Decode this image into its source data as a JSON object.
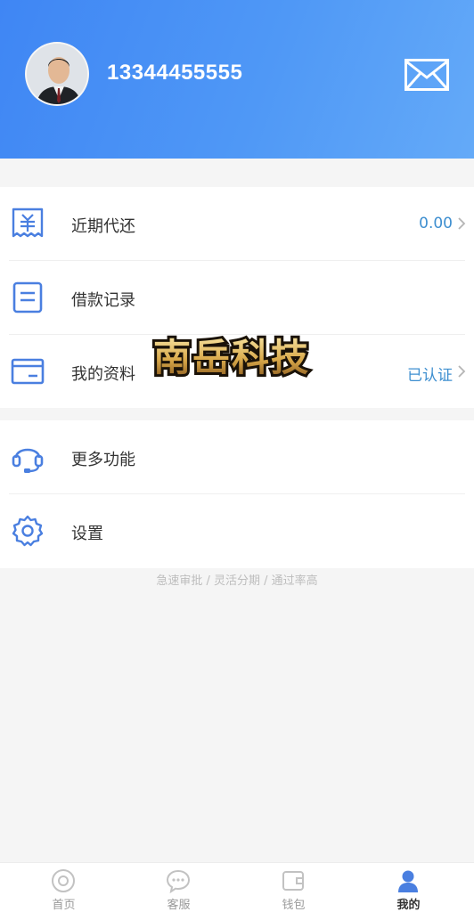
{
  "header": {
    "phone": "13344455555",
    "avatar_icon": "user-avatar",
    "mail_icon": "mail-icon"
  },
  "menu_primary": [
    {
      "label": "近期代还",
      "value": "0.00",
      "icon": "receipt-yuan-icon"
    },
    {
      "label": "借款记录",
      "value": "",
      "icon": "document-icon"
    },
    {
      "label": "我的资料",
      "value": "已认证",
      "icon": "card-icon"
    }
  ],
  "menu_secondary": [
    {
      "label": "更多功能",
      "icon": "headset-icon"
    },
    {
      "label": "设置",
      "icon": "gear-icon"
    }
  ],
  "slogan": "急速审批 / 灵活分期 / 通过率高",
  "watermark": "南岳科技",
  "tabs": [
    {
      "label": "首页",
      "icon": "home-icon"
    },
    {
      "label": "客服",
      "icon": "chat-icon"
    },
    {
      "label": "钱包",
      "icon": "wallet-icon"
    },
    {
      "label": "我的",
      "icon": "user-icon"
    }
  ],
  "colors": {
    "header_start": "#3f86f4",
    "header_end": "#64aaf8",
    "icon_blue": "#4a7fe0",
    "value_blue": "#3e8fd0",
    "tab_active": "#4a7fe0"
  }
}
